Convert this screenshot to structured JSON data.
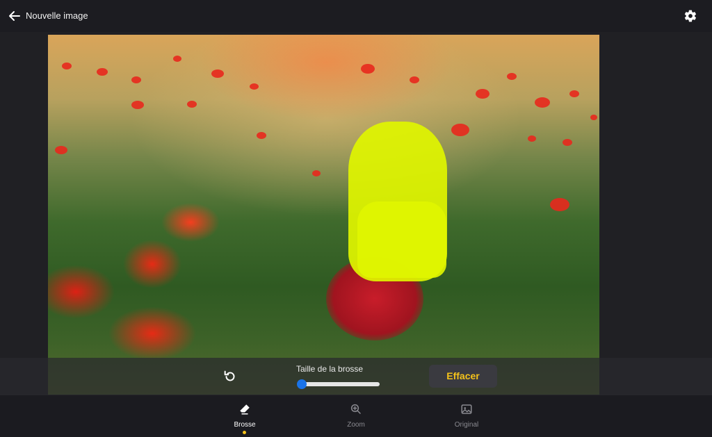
{
  "header": {
    "title": "Nouvelle image",
    "back_icon": "arrow-left-icon",
    "settings_icon": "gear-icon"
  },
  "editor": {
    "brush_label": "Taille de la brosse",
    "brush_size": 0.02,
    "erase_label": "Effacer",
    "undo_icon": "undo-icon",
    "accent_color": "#1a73e8",
    "highlight_color": "#f4c21a",
    "mask_color": "#dff500"
  },
  "bottom_nav": {
    "tabs": [
      {
        "label": "Brosse",
        "icon": "eraser-icon",
        "active": true
      },
      {
        "label": "Zoom",
        "icon": "zoom-in-icon",
        "active": false
      },
      {
        "label": "Original",
        "icon": "image-icon",
        "active": false
      }
    ]
  }
}
